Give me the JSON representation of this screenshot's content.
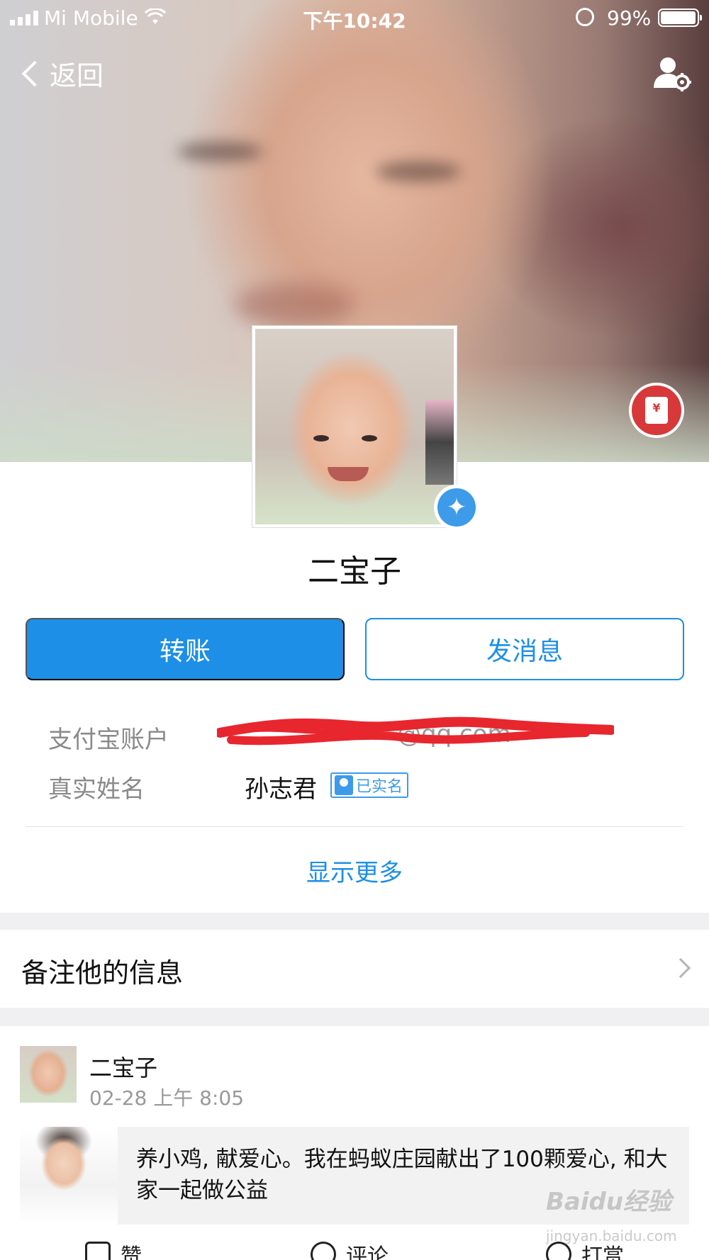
{
  "status_bar": {
    "carrier": "Mi Mobile",
    "time": "下午10:42",
    "battery": "99%"
  },
  "nav": {
    "back_label": "返回"
  },
  "profile": {
    "name": "二宝子",
    "verified": true
  },
  "actions": {
    "transfer_label": "转账",
    "message_label": "发消息"
  },
  "info": {
    "account_label": "支付宝账户",
    "account_value_visible": "@qq.com",
    "realname_label": "真实姓名",
    "realname_value": "孙志君",
    "realname_badge": "已实名"
  },
  "show_more_label": "显示更多",
  "remark_label": "备注他的信息",
  "feed": {
    "author": "二宝子",
    "time": "02-28 上午 8:05",
    "post_text": "养小鸡, 献爱心。我在蚂蚁庄园献出了100颗爱心, 和大家一起做公益",
    "actions": [
      {
        "label": "赞",
        "icon": "thumbs-up-icon"
      },
      {
        "label": "评论",
        "icon": "comment-icon"
      },
      {
        "label": "打赏",
        "icon": "reward-icon"
      }
    ]
  },
  "watermark": {
    "main": "Baidu经验",
    "sub": "jingyan.baidu.com"
  },
  "colors": {
    "primary": "#1d8fe6",
    "redpacket": "#d7393a",
    "badge_blue": "#3d9be9"
  }
}
